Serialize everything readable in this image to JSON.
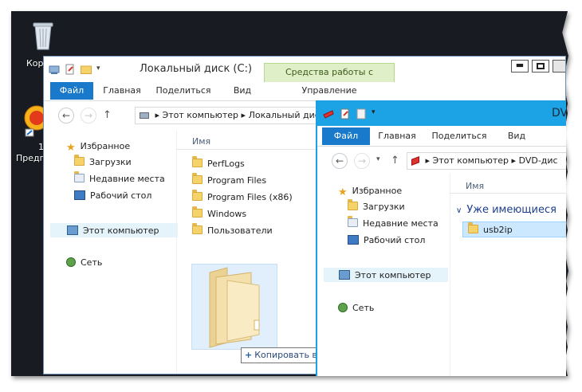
{
  "desktop": {
    "icons": [
      {
        "label": "Кор"
      },
      {
        "label": "1"
      },
      {
        "label": "Предп"
      }
    ]
  },
  "window_c": {
    "title": "Локальный диск (C:)",
    "context_tab": "Средства работы с дисками",
    "context_sub": "Управление",
    "ribbon_tabs": [
      "Файл",
      "Главная",
      "Поделиться",
      "Вид"
    ],
    "address": [
      "Этот компьютер",
      "Локальный диск (C:)"
    ],
    "nav": {
      "favorites": "Избранное",
      "downloads": "Загрузки",
      "recent": "Недавние места",
      "desktop": "Рабочий стол",
      "this_pc": "Этот компьютер",
      "network": "Сеть"
    },
    "column_name": "Имя",
    "files": [
      "PerfLogs",
      "Program Files",
      "Program Files (x86)",
      "Windows",
      "Пользователи"
    ],
    "drag_tooltip": "Копировать в \"Локальный диск (C:)\""
  },
  "window_dvd": {
    "title": "DV",
    "ribbon_tabs": [
      "Файл",
      "Главная",
      "Поделиться",
      "Вид"
    ],
    "address": [
      "Этот компьютер",
      "DVD-дис"
    ],
    "nav": {
      "favorites": "Избранное",
      "downloads": "Загрузки",
      "recent": "Недавние места",
      "desktop": "Рабочий стол",
      "this_pc": "Этот компьютер",
      "network": "Сеть"
    },
    "column_name": "Имя",
    "group_header": "Уже имеющиеся",
    "files": [
      "usb2ip"
    ]
  },
  "colors": {
    "file_tab": "#1979ca",
    "context_tab": "#dff0c8",
    "selection": "#e5f3fb",
    "desktop": "#181c22"
  }
}
